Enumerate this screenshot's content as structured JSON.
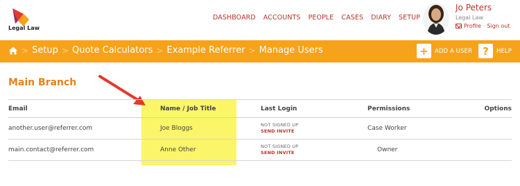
{
  "header": {
    "logo_text": "Legal Law",
    "nav": [
      "DASHBOARD",
      "ACCOUNTS",
      "PEOPLE",
      "CASES",
      "DIARY",
      "SETUP"
    ],
    "user": {
      "name": "Jo Peters",
      "role": "Legal Law",
      "profile_label": "Profile",
      "separator": "·",
      "signout_label": "Sign out"
    }
  },
  "breadcrumb": {
    "items": [
      "Setup",
      "Quote Calculators",
      "Example Referrer",
      "Manage Users"
    ]
  },
  "actions": {
    "add_user_label": "ADD A USER",
    "help_label": "HELP",
    "add_icon_glyph": "+",
    "help_icon_glyph": "?"
  },
  "section": {
    "title": "Main Branch"
  },
  "table": {
    "headers": {
      "email": "Email",
      "name": "Name / Job Title",
      "login": "Last Login",
      "permissions": "Permissions",
      "options": "Options"
    },
    "rows": [
      {
        "email": "another.user@referrer.com",
        "name": "Joe Bloggs",
        "login_status": "NOT SIGNED UP",
        "login_action": "SEND INVITE",
        "permissions": "Case Worker"
      },
      {
        "email": "main.contact@referrer.com",
        "name": "Anne Other",
        "login_status": "NOT SIGNED UP",
        "login_action": "SEND INVITE",
        "permissions": "Owner"
      }
    ]
  },
  "colors": {
    "brand_orange": "#f7a21b",
    "accent_red": "#b5342a",
    "title_orange": "#e8811a",
    "highlight_yellow": "#fbf56a"
  }
}
